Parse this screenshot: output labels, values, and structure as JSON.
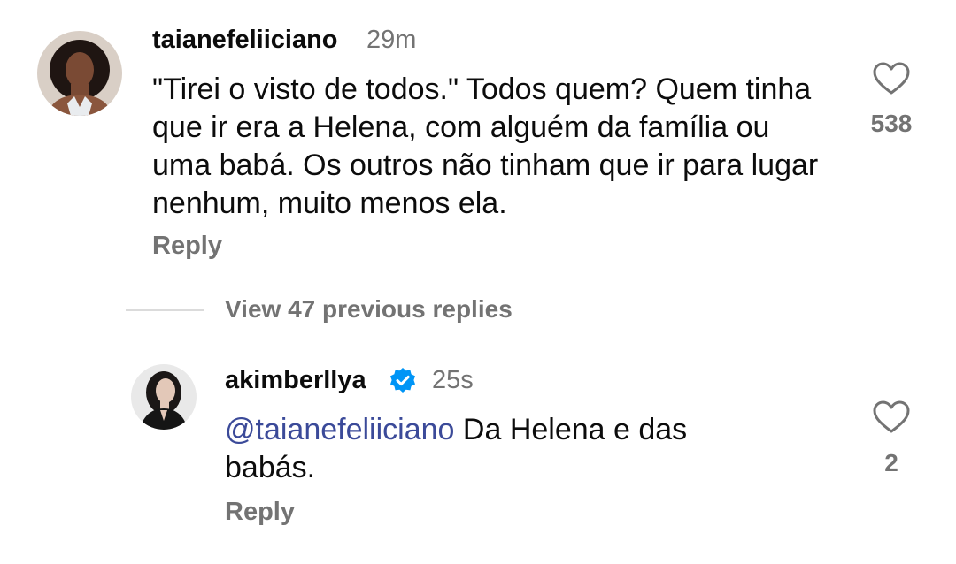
{
  "comments": [
    {
      "username": "taianefeliiciano",
      "time": "29m",
      "text": "\"Tirei o visto de todos.\" Todos quem? Quem tinha que ir era a Helena, com alguém da família ou uma babá. Os outros não tinham que ir para lugar nenhum, muito menos ela.",
      "reply_label": "Reply",
      "likes": "538",
      "like_icon": "heart-outline-icon"
    }
  ],
  "thread": {
    "view_replies_label": "View 47 previous replies"
  },
  "replies": [
    {
      "username": "akimberllya",
      "verified": true,
      "time": "25s",
      "mention": "@taianefeliiciano",
      "text": "Da Helena e das babás.",
      "reply_label": "Reply",
      "likes": "2",
      "like_icon": "heart-outline-icon"
    }
  ],
  "colors": {
    "mention": "#3b4a99",
    "verified": "#0095f6",
    "secondary": "#737373"
  }
}
